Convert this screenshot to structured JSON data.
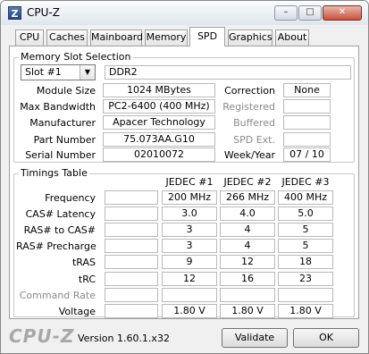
{
  "window": {
    "title": "CPU-Z",
    "icon_letter": "Z"
  },
  "caption_buttons": {
    "minimize": "–",
    "maximize": "□",
    "close": "✕"
  },
  "tabs": [
    "CPU",
    "Caches",
    "Mainboard",
    "Memory",
    "SPD",
    "Graphics",
    "About"
  ],
  "active_tab": "SPD",
  "memory_slot": {
    "section_title": "Memory Slot Selection",
    "slot": "Slot #1",
    "type": "DDR2",
    "labels": {
      "module_size": "Module Size",
      "max_bandwidth": "Max Bandwidth",
      "manufacturer": "Manufacturer",
      "part_number": "Part Number",
      "serial_number": "Serial Number",
      "correction": "Correction",
      "registered": "Registered",
      "buffered": "Buffered",
      "spd_ext": "SPD Ext.",
      "week_year": "Week/Year"
    },
    "values": {
      "module_size": "1024 MBytes",
      "max_bandwidth": "PC2-6400 (400 MHz)",
      "manufacturer": "Apacer Technology",
      "part_number": "75.073AA.G10",
      "serial_number": "02010072",
      "correction": "None",
      "registered": "",
      "buffered": "",
      "spd_ext": "",
      "week_year": "07 / 10"
    }
  },
  "timings": {
    "section_title": "Timings Table",
    "columns": [
      "JEDEC #1",
      "JEDEC #2",
      "JEDEC #3"
    ],
    "rows": [
      {
        "label": "Frequency",
        "values": [
          "200 MHz",
          "266 MHz",
          "400 MHz"
        ],
        "disabled": false
      },
      {
        "label": "CAS# Latency",
        "values": [
          "3.0",
          "4.0",
          "5.0"
        ],
        "disabled": false
      },
      {
        "label": "RAS# to CAS#",
        "values": [
          "3",
          "4",
          "5"
        ],
        "disabled": false
      },
      {
        "label": "RAS# Precharge",
        "values": [
          "3",
          "4",
          "5"
        ],
        "disabled": false
      },
      {
        "label": "tRAS",
        "values": [
          "9",
          "12",
          "18"
        ],
        "disabled": false
      },
      {
        "label": "tRC",
        "values": [
          "12",
          "16",
          "23"
        ],
        "disabled": false
      },
      {
        "label": "Command Rate",
        "values": [
          "",
          "",
          ""
        ],
        "disabled": true
      },
      {
        "label": "Voltage",
        "values": [
          "1.80 V",
          "1.80 V",
          "1.80 V"
        ],
        "disabled": false
      }
    ]
  },
  "footer": {
    "brand": "CPU-Z",
    "version": "Version 1.60.1.x32",
    "validate": "Validate",
    "ok": "OK"
  }
}
